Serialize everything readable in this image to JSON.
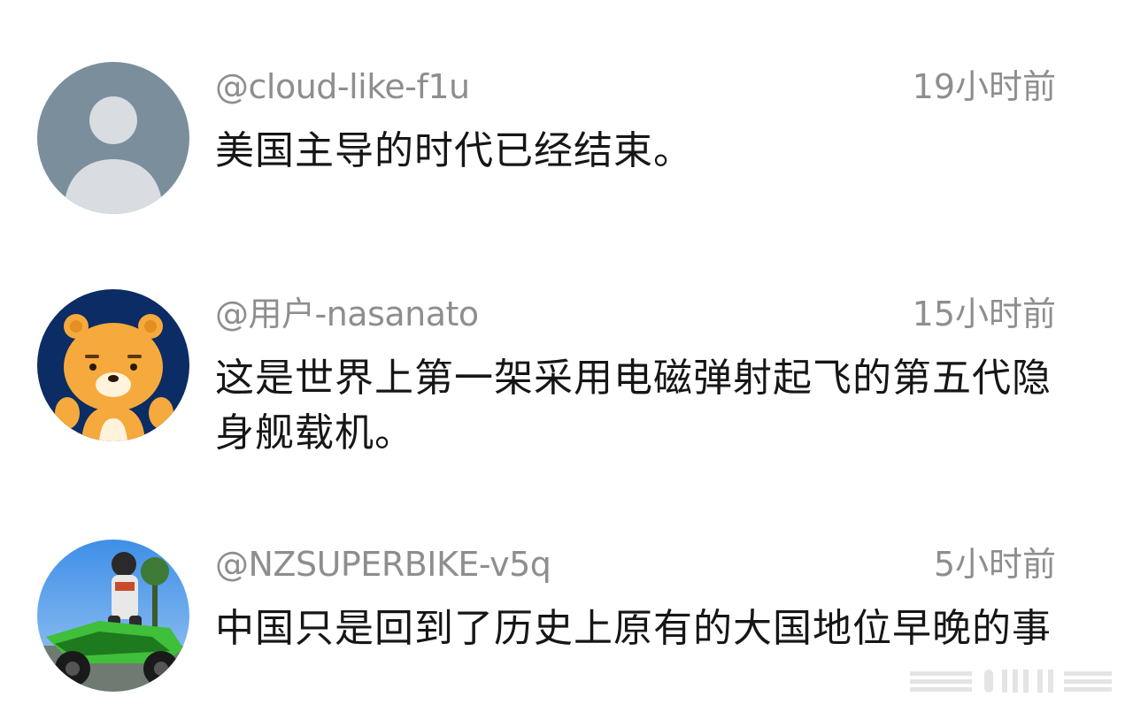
{
  "comments": [
    {
      "username": "@cloud-like-f1u",
      "time": "19小时前",
      "text": "美国主导的时代已经结束。",
      "avatar": "default-person-avatar"
    },
    {
      "username": "@用户-nasanato",
      "time": "15小时前",
      "text": "这是世界上第一架采用电磁弹射起飞的第五代隐身舰载机。",
      "avatar": "cartoon-lion-avatar"
    },
    {
      "username": "@NZSUPERBIKE-v5q",
      "time": "5小时前",
      "text": "中国只是回到了历史上原有的大国地位早晚的事",
      "avatar": "motorcycle-rider-photo-avatar"
    }
  ],
  "colors": {
    "meta_text": "#8e8e8e",
    "body_text": "#161616",
    "default_avatar_bg": "#7b8e9c",
    "default_avatar_figure": "#d9dde2",
    "lion_avatar_bg": "#0b2c64",
    "lion_face": "#f6a93c"
  }
}
